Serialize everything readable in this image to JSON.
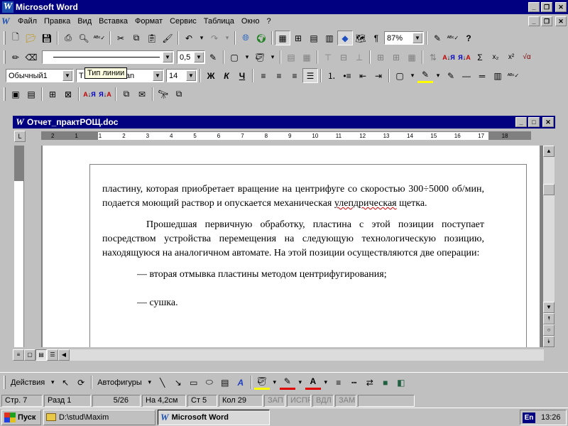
{
  "window": {
    "title": "Microsoft Word"
  },
  "menu": [
    "Файл",
    "Правка",
    "Вид",
    "Вставка",
    "Формат",
    "Сервис",
    "Таблица",
    "Окно",
    "?"
  ],
  "standard_toolbar": {
    "zoom": "87%"
  },
  "drawing_lines_toolbar": {
    "line_width": "0,5"
  },
  "formatting_toolbar": {
    "style": "Обычный1",
    "font": "Times New Roman",
    "font_visible": "T",
    "font_tail": "man",
    "size": "14",
    "bold": "Ж",
    "italic": "К",
    "underline": "Ч"
  },
  "tooltip": "Тип линии",
  "document": {
    "title": "Отчет_практРОЩ.doc",
    "ruler_labels": [
      "2",
      "1",
      "1",
      "2",
      "3",
      "4",
      "5",
      "6",
      "7",
      "8",
      "9",
      "10",
      "11",
      "12",
      "13",
      "14",
      "15",
      "16",
      "17",
      "18"
    ],
    "paragraphs": [
      {
        "text_a": "пластину, которая приобретает вращение на центрифуге со скоростью 300÷5000 об/мин, подается моющий раствор и опускается механическая ",
        "squiggle": "улепдрическая",
        "text_b": " щетка."
      },
      {
        "text": "Прошедшая первичную обработку, пластина с этой позиции поступает посредством устройства перемещения на следующую технологическую позицию, находящуюся на аналогичном автомате. На этой позиции осуществляются две операции:"
      },
      {
        "text": "— вторая отмывка пластины методом центрифугирования;"
      },
      {
        "text": "— сушка."
      }
    ]
  },
  "drawing_toolbar": {
    "actions": "Действия",
    "autoshapes": "Автофигуры"
  },
  "status": {
    "page": "Стр. 7",
    "section": "Разд 1",
    "pages": "5/26",
    "at": "На 4,2см",
    "line": "Ст 5",
    "col": "Кол 29",
    "rec": "ЗАП",
    "trk": "ИСПР",
    "ext": "ВДЛ",
    "ovr": "ЗАМ"
  },
  "taskbar": {
    "start": "Пуск",
    "tasks": [
      "D:\\stud\\Maxim",
      "Microsoft Word"
    ],
    "lang": "En",
    "clock": "13:26"
  }
}
